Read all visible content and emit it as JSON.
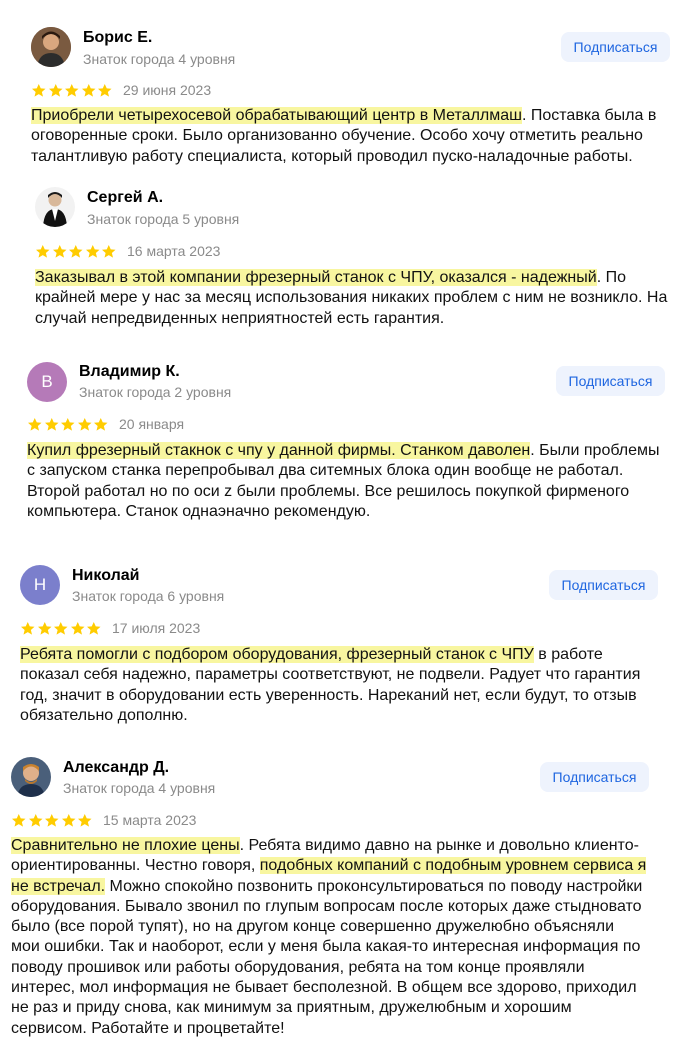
{
  "subscribe_label": "Подписаться",
  "colors": {
    "star": "#fc0",
    "highlight": "#f8f6a0",
    "button_bg": "#eef3fd",
    "button_text": "#1f66e0"
  },
  "reviews": [
    {
      "author": "Борис Е.",
      "level": "Знаток города 4 уровня",
      "rating": 5,
      "date": "29 июня 2023",
      "avatar": "photo",
      "text_parts": [
        {
          "t": "Приобрели четырехосевой обрабатывающий центр в Металлмаш",
          "hl": true
        },
        {
          "t": ". Поставка была в оговоренные сроки. Было организованно обучение. Особо хочу отметить реально талантливую работу специалиста, который проводил пуско-наладочные работы.",
          "hl": false
        }
      ]
    },
    {
      "author": "Сергей А.",
      "level": "Знаток города 5 уровня",
      "rating": 5,
      "date": "16 марта 2023",
      "avatar": "photo",
      "text_parts": [
        {
          "t": "Заказывал в этой компании фрезерный станок с ЧПУ, оказался - надежный",
          "hl": true
        },
        {
          "t": ". По крайней мере у нас за месяц использования никаких проблем с ним не возникло. На случай непредвиденных неприятностей есть гарантия.",
          "hl": false
        }
      ]
    },
    {
      "author": "Владимир К.",
      "level": "Знаток города 2 уровня",
      "rating": 5,
      "date": "20 января",
      "avatar_letter": "В",
      "avatar_color": "#b57ab8",
      "text_parts": [
        {
          "t": "Купил фрезерный стакнок с чпу у данной фирмы. Станком даволен",
          "hl": true
        },
        {
          "t": ". Были проблемы с запуском станка перепробывал два ситемных блока один вообще не работал. Второй работал но по оси z были проблемы. Все решилось покупкой фирменого компьютера. Станок однаэначно рекомендую.",
          "hl": false
        }
      ]
    },
    {
      "author": "Николай",
      "level": "Знаток города 6 уровня",
      "rating": 5,
      "date": "17 июля 2023",
      "avatar_letter": "Н",
      "avatar_color": "#7b7fcc",
      "text_parts": [
        {
          "t": "Ребята помогли с подбором оборудования, фрезерный станок с ЧПУ",
          "hl": true
        },
        {
          "t": " в работе показал себя надежно, параметры соответствуют, не подвели. Радует что гарантия год, значит в оборудовании есть уверенность. Нареканий нет, если будут, то отзыв обязательно дополню.",
          "hl": false
        }
      ]
    },
    {
      "author": "Александр Д.",
      "level": "Знаток города 4 уровня",
      "rating": 5,
      "date": "15 марта 2023",
      "avatar": "photo",
      "text_parts": [
        {
          "t": "Сравнительно не плохие цены",
          "hl": true
        },
        {
          "t": ". Ребята видимо давно на рынке и довольно клиенто-ориентированны. Честно говоря, ",
          "hl": false
        },
        {
          "t": "подобных компаний с подобным уровнем сервиса я не встречал.",
          "hl": true
        },
        {
          "t": " Можно спокойно позвонить проконсультироваться по поводу настройки оборудования. Бывало звонил по глупым вопросам после которых даже стыдновато было (все порой тупят), но на другом конце совершенно дружелюбно объясняли мои ошибки. Так и наоборот, если у меня была какая-то интересная информация по поводу прошивок или работы оборудования, ребята на том конце проявляли интерес, мол информация не бывает бесполезной. В общем все здорово, приходил не раз и приду снова, как минимум за приятным, дружелюбным и хорошим сервисом. Работайте и процветайте!",
          "hl": false
        }
      ]
    }
  ]
}
